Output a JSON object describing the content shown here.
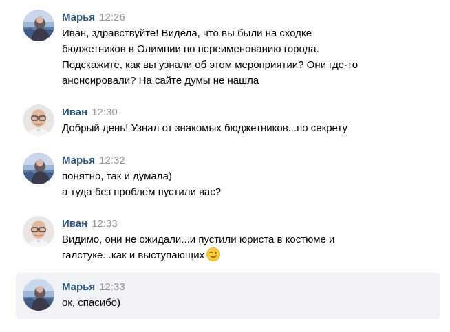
{
  "colors": {
    "author": "#2a5885",
    "time": "#939393",
    "highlight_bg": "#f0f2f5"
  },
  "messages": [
    {
      "author": "Марья",
      "time": "12:26",
      "lines": [
        "Иван, здравствуйте! Видела, что вы были на сходке",
        "бюджетников в Олимпии по переименованию города.",
        "Подскажите, как вы узнали об этом мероприятии? Они где-то",
        "анонсировали? На сайте думы не нашла"
      ]
    },
    {
      "author": "Иван",
      "time": "12:30",
      "lines": [
        "Добрый день! Узнал от знакомых бюджетников...по секрету"
      ]
    },
    {
      "author": "Марья",
      "time": "12:32",
      "lines": [
        "понятно, так и думала)",
        "а туда без проблем пустили вас?"
      ]
    },
    {
      "author": "Иван",
      "time": "12:33",
      "lines": [
        "Видимо, они не ожидали...и пустили юриста в костюме и",
        "галстуке...как и выступающих"
      ],
      "emoji": "winking-face-icon"
    },
    {
      "author": "Марья",
      "time": "12:33",
      "lines": [
        "ок, спасибо)"
      ]
    }
  ]
}
